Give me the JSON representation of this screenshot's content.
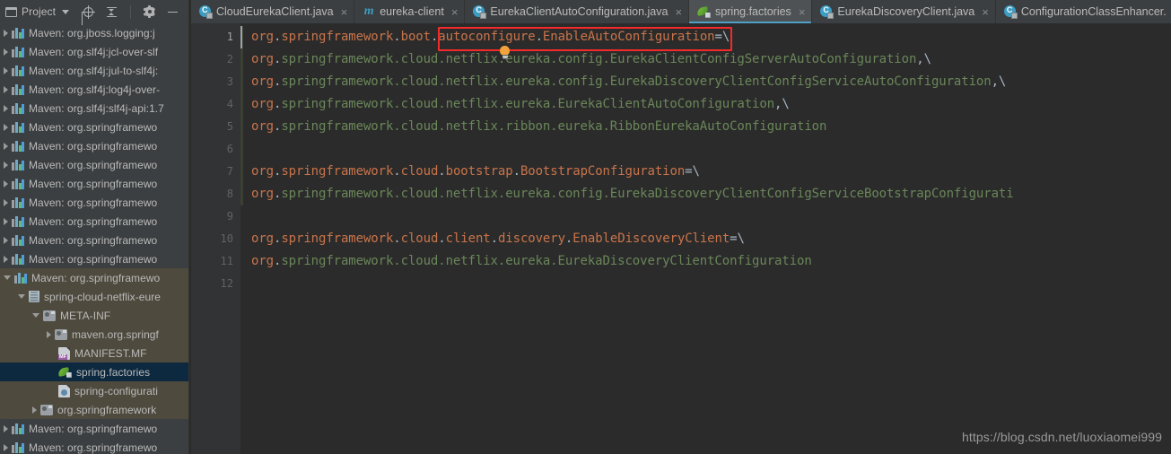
{
  "tool_window": {
    "title": "Project",
    "actions": [
      {
        "name": "locate-icon",
        "label": "Select Opened File"
      },
      {
        "name": "collapse-all-icon",
        "label": "Collapse All"
      },
      {
        "name": "gear-icon",
        "label": "Settings"
      },
      {
        "name": "minimize-icon",
        "label": "Hide"
      }
    ],
    "tree": [
      {
        "indent": 1,
        "arrow": "right",
        "icon": "maven-icon",
        "label": "Maven: org.jboss.logging:j",
        "state": "normal",
        "clipped": true
      },
      {
        "indent": 1,
        "arrow": "right",
        "icon": "maven-icon",
        "label": "Maven: org.slf4j:jcl-over-slf",
        "state": "normal",
        "clipped": true
      },
      {
        "indent": 1,
        "arrow": "right",
        "icon": "maven-icon",
        "label": "Maven: org.slf4j:jul-to-slf4j:",
        "state": "normal",
        "clipped": true
      },
      {
        "indent": 1,
        "arrow": "right",
        "icon": "maven-icon",
        "label": "Maven: org.slf4j:log4j-over-",
        "state": "normal",
        "clipped": true
      },
      {
        "indent": 1,
        "arrow": "right",
        "icon": "maven-icon",
        "label": "Maven: org.slf4j:slf4j-api:1.7",
        "state": "normal",
        "clipped": true
      },
      {
        "indent": 1,
        "arrow": "right",
        "icon": "maven-icon",
        "label": "Maven: org.springframewo",
        "state": "normal",
        "clipped": true
      },
      {
        "indent": 1,
        "arrow": "right",
        "icon": "maven-icon",
        "label": "Maven: org.springframewo",
        "state": "normal",
        "clipped": true
      },
      {
        "indent": 1,
        "arrow": "right",
        "icon": "maven-icon",
        "label": "Maven: org.springframewo",
        "state": "normal",
        "clipped": true
      },
      {
        "indent": 1,
        "arrow": "right",
        "icon": "maven-icon",
        "label": "Maven: org.springframewo",
        "state": "normal",
        "clipped": true
      },
      {
        "indent": 1,
        "arrow": "right",
        "icon": "maven-icon",
        "label": "Maven: org.springframewo",
        "state": "normal",
        "clipped": true
      },
      {
        "indent": 1,
        "arrow": "right",
        "icon": "maven-icon",
        "label": "Maven: org.springframewo",
        "state": "normal",
        "clipped": true
      },
      {
        "indent": 1,
        "arrow": "right",
        "icon": "maven-icon",
        "label": "Maven: org.springframewo",
        "state": "normal",
        "clipped": true
      },
      {
        "indent": 1,
        "arrow": "right",
        "icon": "maven-icon",
        "label": "Maven: org.springframewo",
        "state": "normal",
        "clipped": true
      },
      {
        "indent": 1,
        "arrow": "down",
        "icon": "maven-icon",
        "label": "Maven: org.springframewo",
        "state": "olive",
        "clipped": true
      },
      {
        "indent": 2,
        "arrow": "down",
        "icon": "jar-icon",
        "label": "spring-cloud-netflix-eure",
        "state": "olive",
        "clipped": true
      },
      {
        "indent": 3,
        "arrow": "down",
        "icon": "folder-icon",
        "label": "META-INF",
        "state": "olive",
        "clipped": false
      },
      {
        "indent": 4,
        "arrow": "right",
        "icon": "folder-icon",
        "label": "maven.org.springf",
        "state": "olive",
        "clipped": true
      },
      {
        "indent": 4,
        "arrow": "none",
        "icon": "manifest-icon",
        "label": "MANIFEST.MF",
        "state": "olive",
        "clipped": false
      },
      {
        "indent": 4,
        "arrow": "none",
        "icon": "leaf-icon",
        "label": "spring.factories",
        "state": "selected",
        "clipped": false
      },
      {
        "indent": 4,
        "arrow": "none",
        "icon": "config-icon",
        "label": "spring-configurati",
        "state": "olive",
        "clipped": true
      },
      {
        "indent": 3,
        "arrow": "right",
        "icon": "folder-icon",
        "label": "org.springframework",
        "state": "olive",
        "clipped": true
      },
      {
        "indent": 1,
        "arrow": "right",
        "icon": "maven-icon",
        "label": "Maven: org.springframewo",
        "state": "normal",
        "clipped": true
      },
      {
        "indent": 1,
        "arrow": "right",
        "icon": "maven-icon",
        "label": "Maven: org.springframewo",
        "state": "normal",
        "clipped": true
      }
    ]
  },
  "tabs": [
    {
      "label": "CloudEurekaClient.java",
      "icon": "java-class-icon",
      "active": false,
      "close": "×"
    },
    {
      "label": "eureka-client",
      "icon": "maven-module-icon",
      "active": false,
      "close": "×"
    },
    {
      "label": "EurekaClientAutoConfiguration.java",
      "icon": "java-class-icon",
      "active": false,
      "close": "×"
    },
    {
      "label": "spring.factories",
      "icon": "spring-factories-icon",
      "active": true,
      "close": "×"
    },
    {
      "label": "EurekaDiscoveryClient.java",
      "icon": "java-class-icon",
      "active": false,
      "close": "×"
    },
    {
      "label": "ConfigurationClassEnhancer.",
      "icon": "java-class-icon",
      "active": false,
      "close": ""
    }
  ],
  "editor": {
    "line_numbers": [
      "1",
      "2",
      "3",
      "4",
      "5",
      "6",
      "7",
      "8",
      "9",
      "10",
      "11",
      "12"
    ],
    "current_line": 1,
    "lines": [
      {
        "n": 1,
        "segs": [
          {
            "t": "org",
            "c": "key"
          },
          {
            "t": ".",
            "c": "sep"
          },
          {
            "t": "springframework",
            "c": "key"
          },
          {
            "t": ".",
            "c": "sep"
          },
          {
            "t": "boot",
            "c": "key"
          },
          {
            "t": ".",
            "c": "sep"
          },
          {
            "t": "autoconfigure",
            "c": "key"
          },
          {
            "t": ".",
            "c": "sep"
          },
          {
            "t": "EnableAutoConfiguration",
            "c": "key"
          },
          {
            "t": "=",
            "c": "sep"
          },
          {
            "t": "\\",
            "c": "cont"
          }
        ]
      },
      {
        "n": 2,
        "segs": [
          {
            "t": "org",
            "c": "key"
          },
          {
            "t": ".",
            "c": "sep"
          },
          {
            "t": "springframework.cloud.netflix.eureka.config.EurekaClientConfigServerAutoConfiguration",
            "c": "val"
          },
          {
            "t": ",",
            "c": "sep"
          },
          {
            "t": "\\",
            "c": "cont"
          }
        ]
      },
      {
        "n": 3,
        "segs": [
          {
            "t": "org",
            "c": "key"
          },
          {
            "t": ".",
            "c": "sep"
          },
          {
            "t": "springframework.cloud.netflix.eureka.config.EurekaDiscoveryClientConfigServiceAutoConfiguration",
            "c": "val"
          },
          {
            "t": ",",
            "c": "sep"
          },
          {
            "t": "\\",
            "c": "cont"
          }
        ]
      },
      {
        "n": 4,
        "segs": [
          {
            "t": "org",
            "c": "key"
          },
          {
            "t": ".",
            "c": "sep"
          },
          {
            "t": "springframework.cloud.netflix.eureka.EurekaClientAutoConfiguration",
            "c": "val"
          },
          {
            "t": ",",
            "c": "sep"
          },
          {
            "t": "\\",
            "c": "cont"
          }
        ]
      },
      {
        "n": 5,
        "segs": [
          {
            "t": "org",
            "c": "key"
          },
          {
            "t": ".",
            "c": "sep"
          },
          {
            "t": "springframework.cloud.netflix.ribbon.eureka.RibbonEurekaAutoConfiguration",
            "c": "val"
          }
        ]
      },
      {
        "n": 6,
        "segs": []
      },
      {
        "n": 7,
        "segs": [
          {
            "t": "org",
            "c": "key"
          },
          {
            "t": ".",
            "c": "sep"
          },
          {
            "t": "springframework",
            "c": "key"
          },
          {
            "t": ".",
            "c": "sep"
          },
          {
            "t": "cloud",
            "c": "key"
          },
          {
            "t": ".",
            "c": "sep"
          },
          {
            "t": "bootstrap",
            "c": "key"
          },
          {
            "t": ".",
            "c": "sep"
          },
          {
            "t": "BootstrapConfiguration",
            "c": "key"
          },
          {
            "t": "=",
            "c": "sep"
          },
          {
            "t": "\\",
            "c": "cont"
          }
        ]
      },
      {
        "n": 8,
        "segs": [
          {
            "t": "org",
            "c": "key"
          },
          {
            "t": ".",
            "c": "sep"
          },
          {
            "t": "springframework.cloud.netflix.eureka.config.EurekaDiscoveryClientConfigServiceBootstrapConfigurati",
            "c": "val"
          }
        ]
      },
      {
        "n": 9,
        "segs": []
      },
      {
        "n": 10,
        "segs": [
          {
            "t": "org",
            "c": "key"
          },
          {
            "t": ".",
            "c": "sep"
          },
          {
            "t": "springframework",
            "c": "key"
          },
          {
            "t": ".",
            "c": "sep"
          },
          {
            "t": "cloud",
            "c": "key"
          },
          {
            "t": ".",
            "c": "sep"
          },
          {
            "t": "client",
            "c": "key"
          },
          {
            "t": ".",
            "c": "sep"
          },
          {
            "t": "discovery",
            "c": "key"
          },
          {
            "t": ".",
            "c": "sep"
          },
          {
            "t": "EnableDiscoveryClient",
            "c": "key"
          },
          {
            "t": "=",
            "c": "sep"
          },
          {
            "t": "\\",
            "c": "cont"
          }
        ]
      },
      {
        "n": 11,
        "segs": [
          {
            "t": "org",
            "c": "key"
          },
          {
            "t": ".",
            "c": "sep"
          },
          {
            "t": "springframework.cloud.netflix.eureka.EurekaDiscoveryClientConfiguration",
            "c": "val"
          }
        ]
      },
      {
        "n": 12,
        "segs": []
      }
    ],
    "annotation": {
      "name": "red-highlight-rectangle",
      "color": "#F42A2A",
      "covers": "autoconfigure.EnableAutoConfiguration="
    },
    "intention_bulb": {
      "name": "intention-bulb-icon",
      "color": "#F2A33C",
      "line": 2
    }
  },
  "watermark": "https://blog.csdn.net/luoxiaomei999",
  "colors": {
    "editor_bg": "#2B2B2B",
    "gutter_bg": "#313335",
    "panel_bg": "#3C3F41",
    "key_text": "#C9744A",
    "value_text": "#6A8759",
    "separator_text": "#A9B7C6",
    "tree_highlight": "#4E4A3E",
    "tree_selection": "#0D293F",
    "tab_active_underline": "#4EA0C4"
  }
}
